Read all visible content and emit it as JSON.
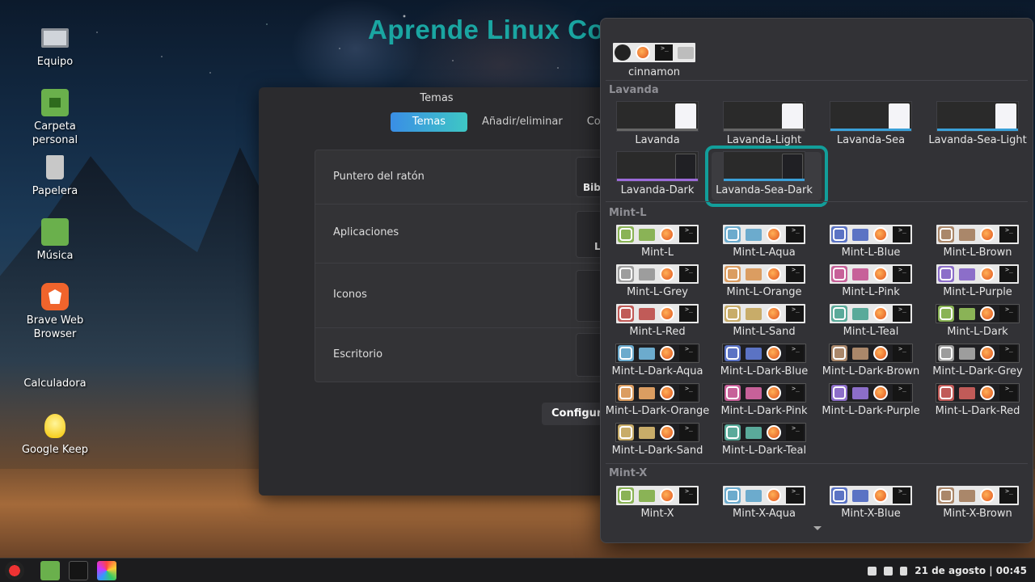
{
  "watermark": "Aprende Linux Conmigo",
  "desktop_icons": [
    {
      "name": "Equipo"
    },
    {
      "name": "Carpeta personal"
    },
    {
      "name": "Papelera"
    },
    {
      "name": "Música"
    },
    {
      "name": "Brave Web Browser"
    },
    {
      "name": "Calculadora"
    },
    {
      "name": "Google Keep"
    }
  ],
  "dialog": {
    "title": "Temas",
    "tabs": [
      "Temas",
      "Añadir/eliminar",
      "Config"
    ],
    "rows": [
      {
        "label": "Puntero del ratón",
        "value": "Biba"
      },
      {
        "label": "Aplicaciones",
        "value": "L"
      },
      {
        "label": "Iconos",
        "value": ""
      },
      {
        "label": "Escritorio",
        "value": ""
      }
    ],
    "config_button": "Configura"
  },
  "themes": {
    "top_item": "cinnamon",
    "sections": [
      "Lavanda",
      "Mint-L",
      "Mint-X"
    ],
    "lavanda": [
      "Lavanda",
      "Lavanda-Light",
      "Lavanda-Sea",
      "Lavanda-Sea-Light",
      "Lavanda-Dark",
      "Lavanda-Sea-Dark"
    ],
    "selected": "Lavanda-Sea-Dark",
    "mint_l": [
      {
        "name": "Mint-L",
        "color": "#8ab356",
        "dark": false
      },
      {
        "name": "Mint-L-Aqua",
        "color": "#6cabcd",
        "dark": false
      },
      {
        "name": "Mint-L-Blue",
        "color": "#5b73c4",
        "dark": false
      },
      {
        "name": "Mint-L-Brown",
        "color": "#aa876a",
        "dark": false
      },
      {
        "name": "Mint-L-Grey",
        "color": "#9d9d9d",
        "dark": false
      },
      {
        "name": "Mint-L-Orange",
        "color": "#db9d61",
        "dark": false
      },
      {
        "name": "Mint-L-Pink",
        "color": "#c76199",
        "dark": false
      },
      {
        "name": "Mint-L-Purple",
        "color": "#8c6ec9",
        "dark": false
      },
      {
        "name": "Mint-L-Red",
        "color": "#c15b58",
        "dark": false
      },
      {
        "name": "Mint-L-Sand",
        "color": "#c8ac69",
        "dark": false
      },
      {
        "name": "Mint-L-Teal",
        "color": "#5aaa9a",
        "dark": false
      },
      {
        "name": "Mint-L-Dark",
        "color": "#8ab356",
        "dark": true
      },
      {
        "name": "Mint-L-Dark-Aqua",
        "color": "#6cabcd",
        "dark": true
      },
      {
        "name": "Mint-L-Dark-Blue",
        "color": "#5b73c4",
        "dark": true
      },
      {
        "name": "Mint-L-Dark-Brown",
        "color": "#aa876a",
        "dark": true
      },
      {
        "name": "Mint-L-Dark-Grey",
        "color": "#9d9d9d",
        "dark": true
      },
      {
        "name": "Mint-L-Dark-Orange",
        "color": "#db9d61",
        "dark": true
      },
      {
        "name": "Mint-L-Dark-Pink",
        "color": "#c76199",
        "dark": true
      },
      {
        "name": "Mint-L-Dark-Purple",
        "color": "#8c6ec9",
        "dark": true
      },
      {
        "name": "Mint-L-Dark-Red",
        "color": "#c15b58",
        "dark": true
      },
      {
        "name": "Mint-L-Dark-Sand",
        "color": "#c8ac69",
        "dark": true
      },
      {
        "name": "Mint-L-Dark-Teal",
        "color": "#5aaa9a",
        "dark": true
      }
    ],
    "mint_x": [
      {
        "name": "Mint-X",
        "color": "#8ab356"
      },
      {
        "name": "Mint-X-Aqua",
        "color": "#6cabcd"
      },
      {
        "name": "Mint-X-Blue",
        "color": "#5b73c4"
      },
      {
        "name": "Mint-X-Brown",
        "color": "#aa876a"
      }
    ]
  },
  "taskbar": {
    "datetime": "21 de agosto | 00:45"
  }
}
